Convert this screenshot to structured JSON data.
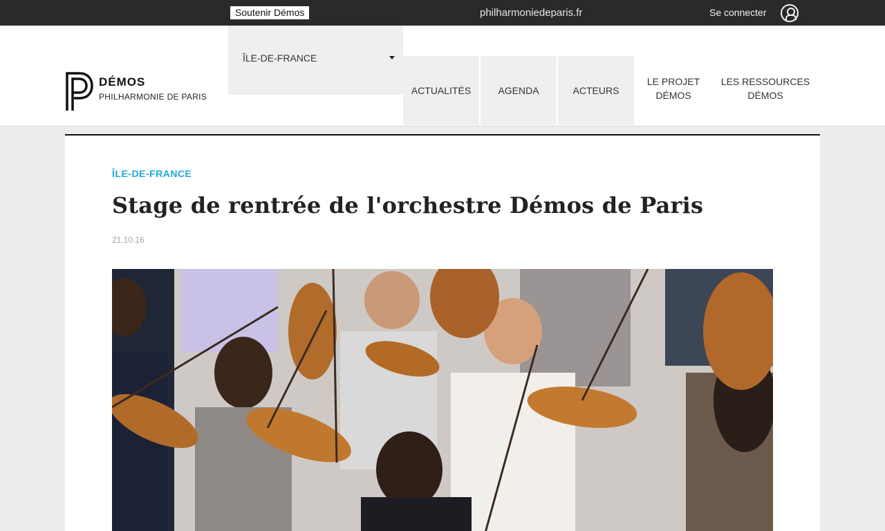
{
  "topbar": {
    "support_label": "Soutenir Démos",
    "site_link": "philharmoniedeparis.fr",
    "login_label": "Se connecter"
  },
  "header": {
    "brand_name": "DÉMOS",
    "brand_sub": "PHILHARMONIE DE PARIS",
    "region": "ÎLE-DE-FRANCE",
    "nav": [
      "ACTUALITÉS",
      "AGENDA",
      "ACTEURS",
      "LE PROJET DÉMOS",
      "LES RESSOURCES DÉMOS"
    ]
  },
  "article": {
    "category": "ÎLE-DE-FRANCE",
    "title": "Stage de rentrée de l'orchestre Démos de Paris",
    "date": "21.10.16"
  },
  "colors": {
    "topbar_bg": "#2a2a2a",
    "accent": "#1ea7e0",
    "nav_bg": "#efefef"
  }
}
